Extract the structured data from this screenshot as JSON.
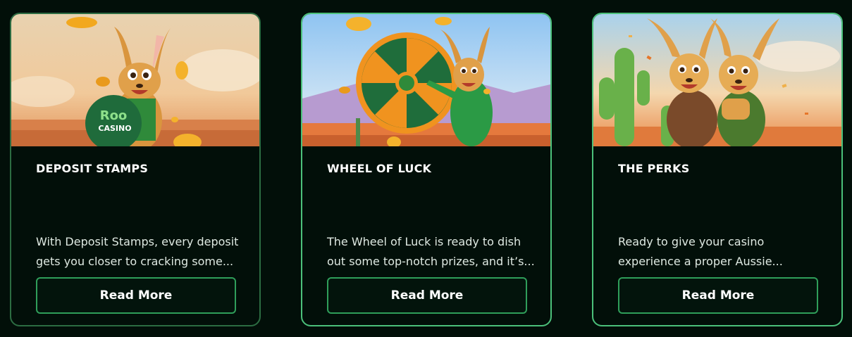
{
  "colors": {
    "background": "#020f09",
    "card_border": "#2c6c42",
    "button_border": "#2f9e5a",
    "accent_green": "#1f8a3f"
  },
  "cards": [
    {
      "title": "DEPOSIT STAMPS",
      "description": "With Deposit Stamps, every deposit gets you closer to cracking some...",
      "button_label": "Read More",
      "image": "kangaroo-holding-roo-casino-badge",
      "badge_text_1": "Roo",
      "badge_text_2": "CASINO"
    },
    {
      "title": "WHEEL OF LUCK",
      "description": "The Wheel of Luck is ready to dish out some top-notch prizes, and it’s...",
      "button_label": "Read More",
      "image": "kangaroo-with-prize-wheel"
    },
    {
      "title": "THE PERKS",
      "description": "Ready to give your casino experience a proper Aussie...",
      "button_label": "Read More",
      "image": "two-kangaroos-hugging-desert"
    }
  ]
}
